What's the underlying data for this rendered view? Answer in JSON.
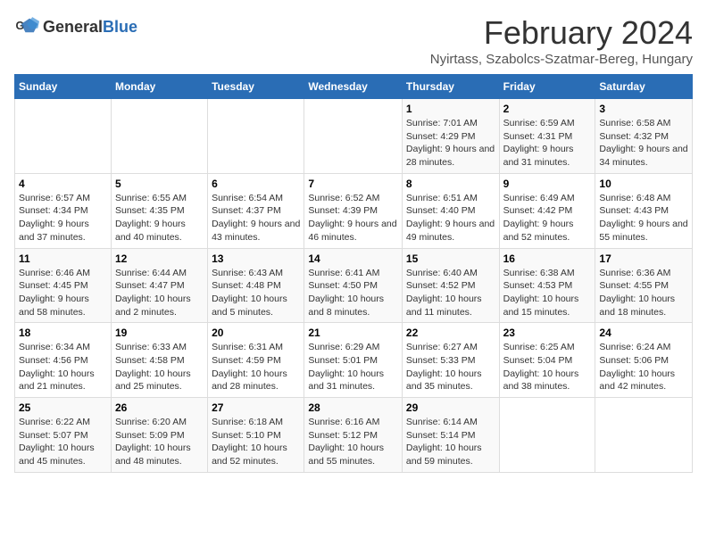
{
  "header": {
    "logo_general": "General",
    "logo_blue": "Blue",
    "month_title": "February 2024",
    "location": "Nyirtass, Szabolcs-Szatmar-Bereg, Hungary"
  },
  "days_of_week": [
    "Sunday",
    "Monday",
    "Tuesday",
    "Wednesday",
    "Thursday",
    "Friday",
    "Saturday"
  ],
  "weeks": [
    [
      {
        "day": "",
        "info": ""
      },
      {
        "day": "",
        "info": ""
      },
      {
        "day": "",
        "info": ""
      },
      {
        "day": "",
        "info": ""
      },
      {
        "day": "1",
        "info": "Sunrise: 7:01 AM\nSunset: 4:29 PM\nDaylight: 9 hours and 28 minutes."
      },
      {
        "day": "2",
        "info": "Sunrise: 6:59 AM\nSunset: 4:31 PM\nDaylight: 9 hours and 31 minutes."
      },
      {
        "day": "3",
        "info": "Sunrise: 6:58 AM\nSunset: 4:32 PM\nDaylight: 9 hours and 34 minutes."
      }
    ],
    [
      {
        "day": "4",
        "info": "Sunrise: 6:57 AM\nSunset: 4:34 PM\nDaylight: 9 hours and 37 minutes."
      },
      {
        "day": "5",
        "info": "Sunrise: 6:55 AM\nSunset: 4:35 PM\nDaylight: 9 hours and 40 minutes."
      },
      {
        "day": "6",
        "info": "Sunrise: 6:54 AM\nSunset: 4:37 PM\nDaylight: 9 hours and 43 minutes."
      },
      {
        "day": "7",
        "info": "Sunrise: 6:52 AM\nSunset: 4:39 PM\nDaylight: 9 hours and 46 minutes."
      },
      {
        "day": "8",
        "info": "Sunrise: 6:51 AM\nSunset: 4:40 PM\nDaylight: 9 hours and 49 minutes."
      },
      {
        "day": "9",
        "info": "Sunrise: 6:49 AM\nSunset: 4:42 PM\nDaylight: 9 hours and 52 minutes."
      },
      {
        "day": "10",
        "info": "Sunrise: 6:48 AM\nSunset: 4:43 PM\nDaylight: 9 hours and 55 minutes."
      }
    ],
    [
      {
        "day": "11",
        "info": "Sunrise: 6:46 AM\nSunset: 4:45 PM\nDaylight: 9 hours and 58 minutes."
      },
      {
        "day": "12",
        "info": "Sunrise: 6:44 AM\nSunset: 4:47 PM\nDaylight: 10 hours and 2 minutes."
      },
      {
        "day": "13",
        "info": "Sunrise: 6:43 AM\nSunset: 4:48 PM\nDaylight: 10 hours and 5 minutes."
      },
      {
        "day": "14",
        "info": "Sunrise: 6:41 AM\nSunset: 4:50 PM\nDaylight: 10 hours and 8 minutes."
      },
      {
        "day": "15",
        "info": "Sunrise: 6:40 AM\nSunset: 4:52 PM\nDaylight: 10 hours and 11 minutes."
      },
      {
        "day": "16",
        "info": "Sunrise: 6:38 AM\nSunset: 4:53 PM\nDaylight: 10 hours and 15 minutes."
      },
      {
        "day": "17",
        "info": "Sunrise: 6:36 AM\nSunset: 4:55 PM\nDaylight: 10 hours and 18 minutes."
      }
    ],
    [
      {
        "day": "18",
        "info": "Sunrise: 6:34 AM\nSunset: 4:56 PM\nDaylight: 10 hours and 21 minutes."
      },
      {
        "day": "19",
        "info": "Sunrise: 6:33 AM\nSunset: 4:58 PM\nDaylight: 10 hours and 25 minutes."
      },
      {
        "day": "20",
        "info": "Sunrise: 6:31 AM\nSunset: 4:59 PM\nDaylight: 10 hours and 28 minutes."
      },
      {
        "day": "21",
        "info": "Sunrise: 6:29 AM\nSunset: 5:01 PM\nDaylight: 10 hours and 31 minutes."
      },
      {
        "day": "22",
        "info": "Sunrise: 6:27 AM\nSunset: 5:33 PM\nDaylight: 10 hours and 35 minutes."
      },
      {
        "day": "23",
        "info": "Sunrise: 6:25 AM\nSunset: 5:04 PM\nDaylight: 10 hours and 38 minutes."
      },
      {
        "day": "24",
        "info": "Sunrise: 6:24 AM\nSunset: 5:06 PM\nDaylight: 10 hours and 42 minutes."
      }
    ],
    [
      {
        "day": "25",
        "info": "Sunrise: 6:22 AM\nSunset: 5:07 PM\nDaylight: 10 hours and 45 minutes."
      },
      {
        "day": "26",
        "info": "Sunrise: 6:20 AM\nSunset: 5:09 PM\nDaylight: 10 hours and 48 minutes."
      },
      {
        "day": "27",
        "info": "Sunrise: 6:18 AM\nSunset: 5:10 PM\nDaylight: 10 hours and 52 minutes."
      },
      {
        "day": "28",
        "info": "Sunrise: 6:16 AM\nSunset: 5:12 PM\nDaylight: 10 hours and 55 minutes."
      },
      {
        "day": "29",
        "info": "Sunrise: 6:14 AM\nSunset: 5:14 PM\nDaylight: 10 hours and 59 minutes."
      },
      {
        "day": "",
        "info": ""
      },
      {
        "day": "",
        "info": ""
      }
    ]
  ]
}
